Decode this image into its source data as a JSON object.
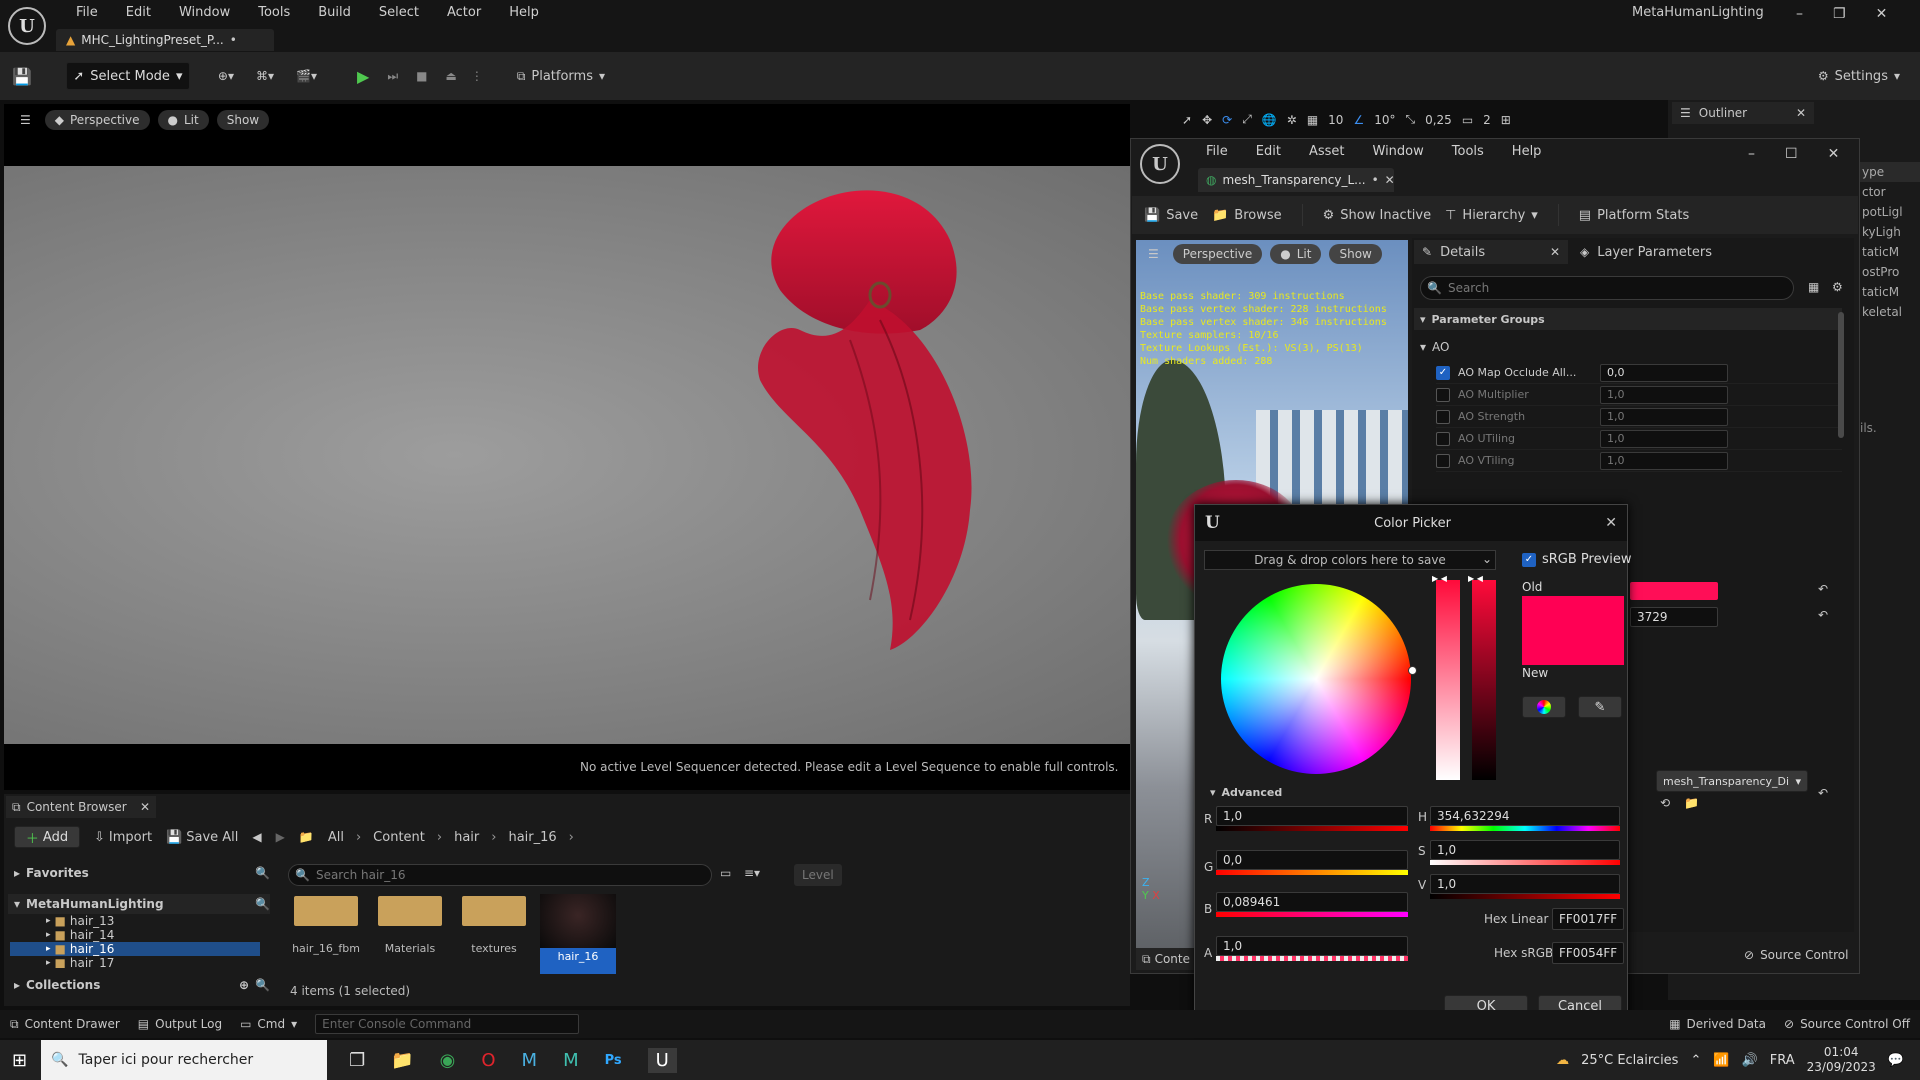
{
  "menu": [
    "File",
    "Edit",
    "Window",
    "Tools",
    "Build",
    "Select",
    "Actor",
    "Help"
  ],
  "app_title": "MetaHumanLighting",
  "tab": {
    "name": "MHC_LightingPreset_P...",
    "dot": "•"
  },
  "toolbar": {
    "select_mode": "Select Mode",
    "platforms": "Platforms",
    "settings": "Settings"
  },
  "viewport": {
    "perspective": "Perspective",
    "lit": "Lit",
    "show": "Show",
    "snap_grid": "10",
    "snap_angle": "10°",
    "snap_scale": "0,25",
    "cam_speed": "2",
    "sequencer_msg": "No active Level Sequencer detected. Please edit a Level Sequence to enable full controls."
  },
  "outliner": {
    "title": "Outliner",
    "col_type": "ype",
    "items": [
      "ctor",
      "potLigl",
      "kyLigh",
      "taticM",
      "ostPro",
      "taticM",
      "keletal"
    ],
    "info": "ils."
  },
  "material_editor": {
    "menu": [
      "File",
      "Edit",
      "Asset",
      "Window",
      "Tools",
      "Help"
    ],
    "tab": "mesh_Transparency_L...",
    "tab_dot": "•",
    "toolbar": {
      "save": "Save",
      "browse": "Browse",
      "show_inactive": "Show Inactive",
      "hierarchy": "Hierarchy",
      "platform_stats": "Platform Stats"
    },
    "viewport": {
      "perspective": "Perspective",
      "lit": "Lit",
      "show": "Show"
    },
    "stats": [
      "Base pass shader: 309 instructions",
      "Base pass vertex shader: 228 instructions",
      "Base pass vertex shader: 346 instructions",
      "Texture samplers: 10/16",
      "Texture Lookups (Est.): VS(3), PS(13)",
      "Num shaders added: 288"
    ],
    "content_tab": "Conte",
    "details": {
      "tab": "Details",
      "layer_tab": "Layer Parameters",
      "search_placeholder": "Search",
      "group_header": "Parameter Groups",
      "ao_group": "AO",
      "params": [
        {
          "name": "AO Map Occlude All...",
          "value": "0,0",
          "on": true
        },
        {
          "name": "AO Multiplier",
          "value": "1,0",
          "on": false
        },
        {
          "name": "AO Strength",
          "value": "1,0",
          "on": false
        },
        {
          "name": "AO UTiling",
          "value": "1,0",
          "on": false
        },
        {
          "name": "AO VTiling",
          "value": "1,0",
          "on": false
        }
      ],
      "partial_value": "3729",
      "texture_select": "mesh_Transparency_Di"
    }
  },
  "color_picker": {
    "title": "Color Picker",
    "dropzone": "Drag & drop colors here to save",
    "srgb_preview": "sRGB Preview",
    "old_label": "Old",
    "new_label": "New",
    "advanced": "Advanced",
    "r_label": "R",
    "r": "1,0",
    "g_label": "G",
    "g": "0,0",
    "b_label": "B",
    "b": "0,089461",
    "a_label": "A",
    "a": "1,0",
    "h_label": "H",
    "h": "354,632294",
    "s_label": "S",
    "s": "1,0",
    "v_label": "V",
    "v": "1,0",
    "hex_linear_label": "Hex Linear",
    "hex_linear": "FF0017FF",
    "hex_srgb_label": "Hex sRGB",
    "hex_srgb": "FF0054FF",
    "ok": "OK",
    "cancel": "Cancel",
    "color_old": "#ff0054",
    "color_new": "#ff0054"
  },
  "content_browser": {
    "title": "Content Browser",
    "add": "Add",
    "import": "Import",
    "save_all": "Save All",
    "breadcrumb": [
      "All",
      "Content",
      "hair",
      "hair_16"
    ],
    "favorites": "Favorites",
    "project": "MetaHumanLighting",
    "tree": [
      "hair_13",
      "hair_14",
      "hair_16",
      "hair_17"
    ],
    "collections": "Collections",
    "search_placeholder": "Search hair_16",
    "level_chip": "Level",
    "assets": [
      "hair_16_fbm",
      "Materials",
      "textures",
      "hair_16"
    ],
    "status": "4 items (1 selected)"
  },
  "bottom_bar": {
    "content_drawer": "Content Drawer",
    "output_log": "Output Log",
    "cmd": "Cmd",
    "console_placeholder": "Enter Console Command",
    "derived_data": "Derived Data",
    "source_control_off": "Source Control Off",
    "source_control": "Source Control"
  },
  "taskbar": {
    "search_placeholder": "Taper ici pour rechercher",
    "weather": "25°C  Eclaircies",
    "lang": "FRA",
    "time": "01:04",
    "date": "23/09/2023"
  }
}
